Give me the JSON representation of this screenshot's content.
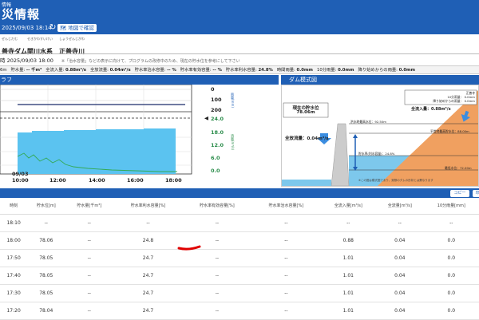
{
  "header": {
    "sub": "情報",
    "title": "災情報"
  },
  "toolbar": {
    "datetime": "2025/09/03 18:14",
    "refresh_icon": "refresh-icon",
    "map_label": "地図で確認"
  },
  "dam": {
    "name_ruby": "ぜんじだむ",
    "name": "善寺ダム",
    "system_ruby": "せきかわすいけい",
    "system": "関川水系",
    "river_ruby": "しょうぜんじがわ",
    "river": "正善寺川"
  },
  "observation": {
    "label": "2025/09/03 18:00",
    "note": "※「治水容量」などの表示に向けて、プログラムの改修中のため、現在の貯水位を参考にして下さい"
  },
  "stats": [
    {
      "label": "6m",
      "value": ""
    },
    {
      "label": "貯水量:",
      "value": "-- 千m³"
    },
    {
      "label": "全流入量:",
      "value": "0.88m³/s"
    },
    {
      "label": "全放流量:",
      "value": "0.04m³/s"
    },
    {
      "label": "貯水率治水容量:",
      "value": "-- %"
    },
    {
      "label": "貯水率有効容量:",
      "value": "-- %"
    },
    {
      "label": "貯水率利水容量:",
      "value": "24.8%"
    },
    {
      "label": "時間雨量:",
      "value": "0.0mm"
    },
    {
      "label": "10分雨量:",
      "value": "0.0mm"
    },
    {
      "label": "降り始めからの雨量:",
      "value": "0.0mm"
    }
  ],
  "graph": {
    "title": "ラフ",
    "top_ticks": [
      "0",
      "100",
      "200"
    ],
    "bottom_ticks": [
      "24.0",
      "18.0",
      "12.0",
      "6.0",
      "0.0"
    ],
    "axis_label_top": "雨量(mm)",
    "axis_label_bottom": "流量(m³/s)",
    "date_label": "09/03",
    "x_ticks": [
      "10:00",
      "12:00",
      "14:00",
      "16:00",
      "18:00"
    ],
    "colors": {
      "fill": "#5bc3f0",
      "line": "#33aa55",
      "rain": "#1b2b6b"
    }
  },
  "dam_panel": {
    "title": "ダム模式図",
    "current_label": "現在の貯水位",
    "current_value": "78.06m",
    "inflow_label": "全流入量：",
    "inflow_value": "0.88m³/s",
    "outflow_label": "全放流量：",
    "outflow_value": "0.04m³/s",
    "flood_level": "洪水時最高水位：92.50m",
    "normal_level": "平常時最高貯水位：88.00m",
    "lowest_level": "最低水位：72.00m",
    "storage_rate": "貯水率(利水容量)：24.8%",
    "rain_box": {
      "line1": "正善寺",
      "line2": "10分雨量：",
      "line2v": "0.0mm",
      "line3": "降り始めからの雨量：",
      "line3v": "0.0mm"
    },
    "footnote": "※この図は模式図であり、実際のダムの形状とは異なります",
    "colors": {
      "water": "#7dc8ec",
      "dam": "#cccccc",
      "earth": "#f0a060"
    }
  },
  "table_buttons": [
    "コピー",
    "印"
  ],
  "table": {
    "headers": [
      "時刻",
      "貯水位[m]",
      "貯水量[千m³]",
      "貯水率利水容量[%]",
      "貯水率有効容量[%]",
      "貯水率治水容量[%]",
      "全流入量[m³/s]",
      "全流量[m³/s]",
      "10分雨量[mm]"
    ],
    "rows": [
      [
        "18:10",
        "--",
        "--",
        "--",
        "--",
        "--",
        "--",
        "--",
        "--"
      ],
      [
        "18:00",
        "78.06",
        "--",
        "24.8",
        "--",
        "--",
        "0.88",
        "0.04",
        "0.0"
      ],
      [
        "17:50",
        "78.05",
        "--",
        "24.7",
        "--",
        "--",
        "1.01",
        "0.04",
        "0.0"
      ],
      [
        "17:40",
        "78.05",
        "--",
        "24.7",
        "--",
        "--",
        "1.01",
        "0.04",
        "0.0"
      ],
      [
        "17:30",
        "78.05",
        "--",
        "24.7",
        "--",
        "--",
        "1.01",
        "0.04",
        "0.0"
      ],
      [
        "17:20",
        "78.04",
        "--",
        "24.7",
        "--",
        "--",
        "1.01",
        "0.04",
        "0.0"
      ]
    ]
  }
}
